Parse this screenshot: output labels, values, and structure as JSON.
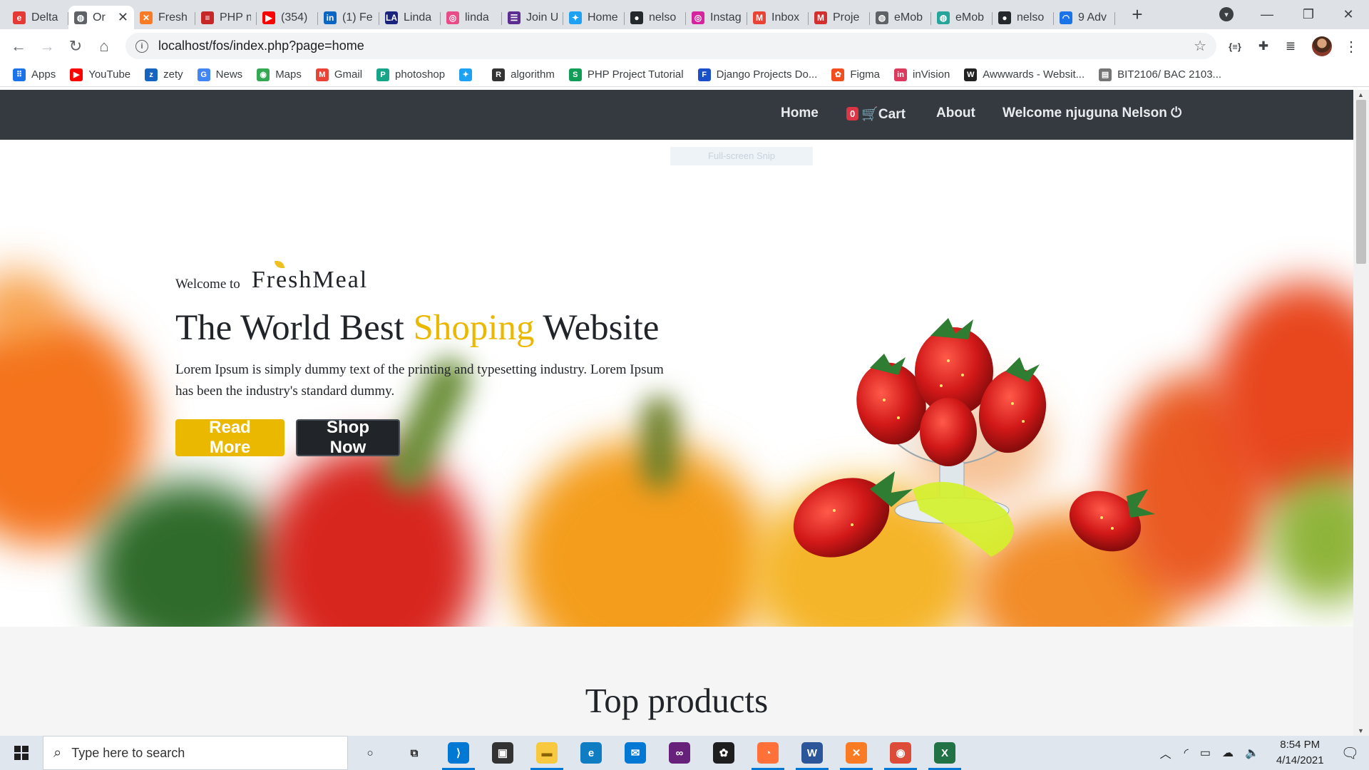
{
  "browser": {
    "tabs": [
      {
        "title": "Delta",
        "icon": "e-icon",
        "color": "#e53935",
        "active": false
      },
      {
        "title": "Or",
        "icon": "globe-icon",
        "color": "#5f6368",
        "active": true
      },
      {
        "title": "Fresh",
        "icon": "xampp-icon",
        "color": "#fb7a24",
        "active": false
      },
      {
        "title": "PHP n",
        "icon": "flag-icon",
        "color": "#c62828",
        "active": false
      },
      {
        "title": "(354)",
        "icon": "youtube-icon",
        "color": "#ff0000",
        "active": false
      },
      {
        "title": "(1) Fe",
        "icon": "linkedin-icon",
        "color": "#0a66c2",
        "active": false
      },
      {
        "title": "Linda",
        "icon": "la-icon",
        "color": "#1a237e",
        "active": false
      },
      {
        "title": "linda",
        "icon": "dribbble-icon",
        "color": "#ea4c89",
        "active": false
      },
      {
        "title": "Join U",
        "icon": "list-icon",
        "color": "#5c2d91",
        "active": false
      },
      {
        "title": "Home",
        "icon": "twitter-icon",
        "color": "#1da1f2",
        "active": false
      },
      {
        "title": "nelso",
        "icon": "github-icon",
        "color": "#24292e",
        "active": false
      },
      {
        "title": "Instag",
        "icon": "instagram-icon",
        "color": "#d6249f",
        "active": false
      },
      {
        "title": "Inbox",
        "icon": "gmail-icon",
        "color": "#ea4335",
        "active": false
      },
      {
        "title": "Proje",
        "icon": "m-icon",
        "color": "#d32f2f",
        "active": false
      },
      {
        "title": "eMob",
        "icon": "globe-icon",
        "color": "#5f6368",
        "active": false
      },
      {
        "title": "eMob",
        "icon": "globe-icon",
        "color": "#26a69a",
        "active": false
      },
      {
        "title": "nelso",
        "icon": "github-icon",
        "color": "#24292e",
        "active": false
      },
      {
        "title": "9 Adv",
        "icon": "loading-icon",
        "color": "#1a73e8",
        "active": false
      }
    ],
    "new_tab_label": "+",
    "window_controls": {
      "minimize": "—",
      "restore": "❐",
      "close": "✕"
    },
    "url": "localhost/fos/index.php?page=home",
    "bookmarks": [
      {
        "label": "Apps",
        "icon": "apps-grid-icon",
        "color": "#1a73e8"
      },
      {
        "label": "YouTube",
        "icon": "youtube-icon",
        "color": "#ff0000"
      },
      {
        "label": "zety",
        "icon": "zety-icon",
        "color": "#1565c0"
      },
      {
        "label": "News",
        "icon": "news-icon",
        "color": "#4285f4"
      },
      {
        "label": "Maps",
        "icon": "maps-pin-icon",
        "color": "#34a853"
      },
      {
        "label": "Gmail",
        "icon": "gmail-icon",
        "color": "#ea4335"
      },
      {
        "label": "photoshop",
        "icon": "photoshop-icon",
        "color": "#17a589"
      },
      {
        "label": "",
        "icon": "twitter-icon",
        "color": "#1da1f2"
      },
      {
        "label": "algorithm",
        "icon": "r-braces-icon",
        "color": "#333333"
      },
      {
        "label": "PHP Project Tutorial",
        "icon": "s-icon",
        "color": "#0f9d58"
      },
      {
        "label": "Django Projects Do...",
        "icon": "f-icon",
        "color": "#1a4fc9"
      },
      {
        "label": "Figma",
        "icon": "figma-icon",
        "color": "#f24e1e"
      },
      {
        "label": "inVision",
        "icon": "invision-icon",
        "color": "#dc395f"
      },
      {
        "label": "Awwwards - Websit...",
        "icon": "w-icon",
        "color": "#222222"
      },
      {
        "label": "BIT2106/ BAC 2103...",
        "icon": "doc-icon",
        "color": "#757575"
      }
    ]
  },
  "site": {
    "nav": {
      "home": "Home",
      "cart_count": "0",
      "cart": "Cart",
      "about": "About",
      "welcome": "Welcome njuguna Nelson"
    },
    "overlay_hint": "Full-screen Snip",
    "hero": {
      "welcome_prefix": "Welcome to",
      "brand": "FreshMeal",
      "headline_start": "The World Best",
      "headline_accent": "Shoping",
      "headline_end": "Website",
      "lead": "Lorem Ipsum is simply dummy text of the printing and typesetting industry. Lorem Ipsum has been the industry's standard dummy.",
      "read_more": "Read More",
      "shop_now": "Shop Now"
    },
    "section_title": "Top products",
    "colors": {
      "accent": "#ebb800",
      "nav_bg": "#343a40",
      "dark_button": "#212529"
    }
  },
  "taskbar": {
    "search_placeholder": "Type here to search",
    "apps": [
      {
        "name": "cortana-icon",
        "open": false
      },
      {
        "name": "task-view-icon",
        "open": false
      },
      {
        "name": "vscode-icon",
        "open": true
      },
      {
        "name": "store-icon",
        "open": false
      },
      {
        "name": "file-explorer-icon",
        "open": true
      },
      {
        "name": "edge-icon",
        "open": false
      },
      {
        "name": "mail-icon",
        "open": false
      },
      {
        "name": "visual-studio-icon",
        "open": false
      },
      {
        "name": "figma-icon",
        "open": false
      },
      {
        "name": "firefox-icon",
        "open": true
      },
      {
        "name": "word-icon",
        "open": true
      },
      {
        "name": "xampp-icon",
        "open": true
      },
      {
        "name": "chrome-icon",
        "open": true
      },
      {
        "name": "excel-icon",
        "open": true
      }
    ],
    "time": "8:54 PM",
    "date": "4/14/2021"
  }
}
